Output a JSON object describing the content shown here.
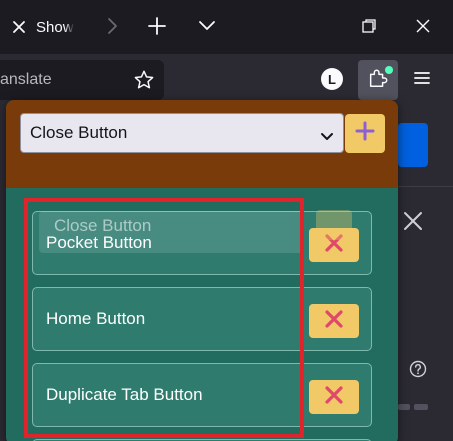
{
  "browser": {
    "tab_title": "Show",
    "url_text": "anslate",
    "account_initial": "L",
    "icons": [
      "close-icon",
      "chevron-right-icon",
      "plus-icon",
      "chevron-down-icon",
      "restore-icon",
      "star-icon",
      "puzzle-icon",
      "hamburger-menu-icon"
    ]
  },
  "popup": {
    "select": {
      "value": "Close Button",
      "icon": "chevron-down-icon"
    },
    "add_button": {
      "icon": "plus-icon"
    },
    "drag_ghost_label": "Close Button",
    "items": [
      {
        "label": "Pocket Button",
        "delete_icon": "x-icon"
      },
      {
        "label": "Home Button",
        "delete_icon": "x-icon"
      },
      {
        "label": "Duplicate Tab Button",
        "delete_icon": "x-icon"
      }
    ]
  },
  "colors": {
    "header_brown": "#7a3b0a",
    "body_teal": "#226b5f",
    "item_teal": "#2f7c6f",
    "button_yellow": "#f1c967",
    "delete_x": "#e0476b",
    "plus_purple": "#8b5fd6",
    "annotation_red": "#e0242c",
    "page_blue": "#0060df",
    "extension_dot": "#54ffbd"
  }
}
